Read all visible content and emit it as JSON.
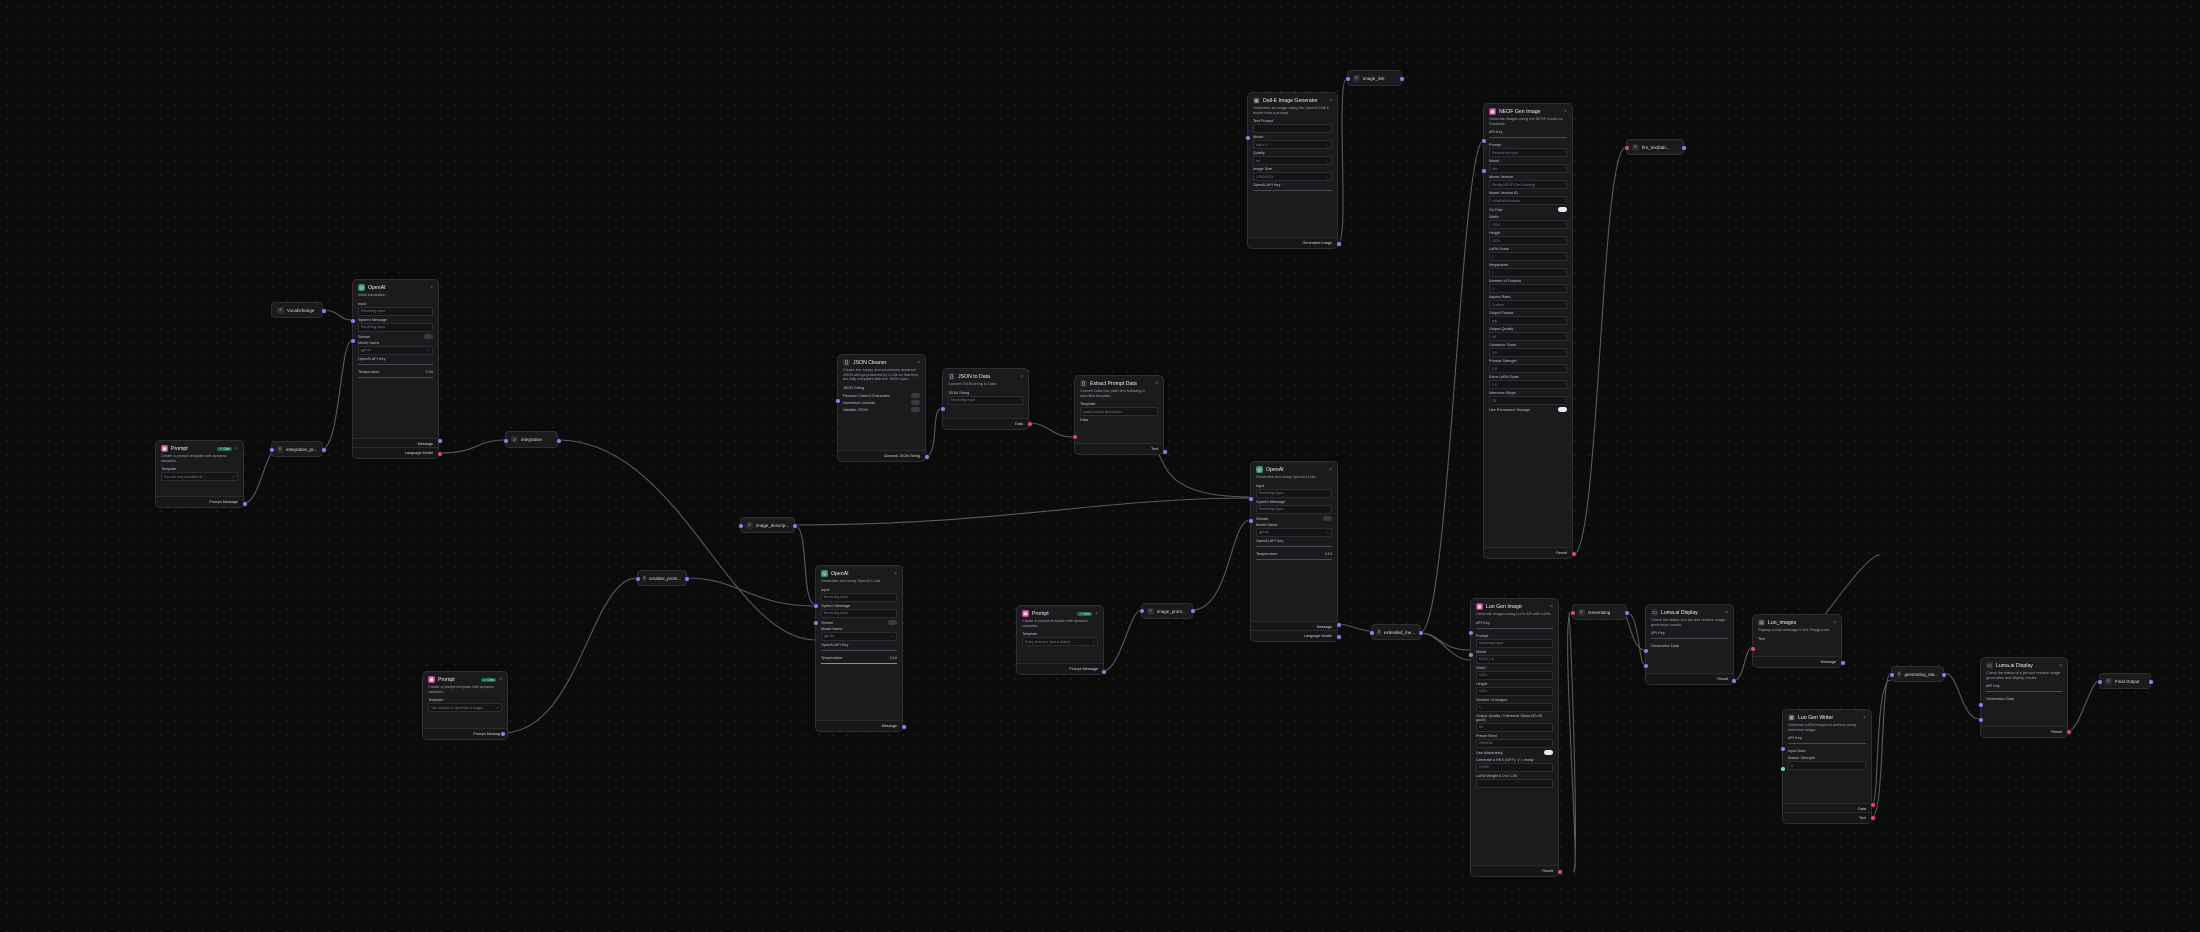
{
  "nodes": {
    "prompt1": {
      "title": "Prompt",
      "badge": "✓ Gen",
      "desc": "Create a prompt template with dynamic variables.",
      "template_label": "Template",
      "template_value": "You are very excellent at ...",
      "output": "Prompt Message"
    },
    "vocab": {
      "title": "Vocabchange"
    },
    "integration_pr": {
      "title": "integration_pr..."
    },
    "integration": {
      "title": "integration"
    },
    "openai1": {
      "title": "OpenAI",
      "desc": "Initial translation",
      "input_label": "Input",
      "input_ph": "Receiving input",
      "sys_label": "System Message",
      "sys_ph": "Receiving input",
      "stream_label": "Stream",
      "model_label": "Model Name",
      "model_value": "gpt-4o",
      "key_label": "OpenAI API Key",
      "temp_label": "Temperature",
      "temp_value": "0.20",
      "out1": "Message",
      "out2": "Language Model"
    },
    "creative_prom": {
      "title": "creative_prom..."
    },
    "prompt2": {
      "title": "Prompt",
      "badge": "✓ Gen",
      "desc": "Create a prompt template with dynamic variables.",
      "template_label": "Template",
      "template_value": "You must be to generate a image...",
      "output": "Prompt Message"
    },
    "json_cleaner": {
      "title": "JSON Cleaner",
      "desc": "Cleans the messy and sometimes incorrect JSON strings produced by LLMs so that they are fully compliant with the JSON spec.",
      "in_label": "JSON String",
      "t1": "Remove Control Characters",
      "t2": "Normalize Unicode",
      "t3": "Validate JSON",
      "output": "Cleaned JSON String"
    },
    "json_to_data": {
      "title": "JSON to Data",
      "desc": "Convert JSON string to Data",
      "in_label": "JSON String",
      "in_ph": "Receiving input",
      "output": "Data"
    },
    "parse_data": {
      "title": "Extract Prompt Data",
      "desc": "Convert Data into plain text following a specified template.",
      "template_label": "Template",
      "template_ph": "{data} extract description",
      "data_label": "Data",
      "output": "Text"
    },
    "image_descrip": {
      "title": "image_descrip..."
    },
    "openai2": {
      "title": "OpenAI",
      "desc": "Generates text using OpenAI LLMs.",
      "input_label": "Input",
      "input_ph": "Receiving input",
      "sys_label": "System Message",
      "sys_ph": "Receiving input",
      "stream_label": "Stream",
      "model_label": "Model Name",
      "model_value": "gpt-4o",
      "key_label": "OpenAI API Key",
      "temp_label": "Temperature",
      "temp_value": "0.10",
      "out1": "Message"
    },
    "prompt3": {
      "title": "Prompt",
      "badge": "✓ Gen",
      "desc": "Create a prompt template with dynamic variables.",
      "template_label": "Template",
      "template_value": "Every time you start a chat to ...",
      "output": "Prompt Message"
    },
    "image_prom": {
      "title": "image_prom..."
    },
    "openai3": {
      "title": "OpenAI",
      "desc": "Generates text using OpenAI LLMs.",
      "input_label": "Input",
      "input_ph": "Receiving input",
      "sys_label": "System Message",
      "sys_ph": "Receiving input",
      "stream_label": "Stream",
      "model_label": "Model Name",
      "model_value": "gpt-4o",
      "key_label": "OpenAI API Key",
      "temp_label": "Temperature",
      "temp_value": "0.10",
      "out1": "Message",
      "out2": "Language Model"
    },
    "dalle": {
      "title": "Dall-E Image Generator",
      "desc": "Generates an image using the OpenAI Dall-E model from a prompt.",
      "prompt_label": "Text Prompt",
      "model_label": "Model",
      "model_value": "dall-e-3",
      "quality_label": "Quality",
      "quality_value": "hd",
      "size_label": "Image Size",
      "size_value": "1792x1024",
      "key_label": "OpenAI API Key",
      "output": "Generated Image"
    },
    "image_link": {
      "title": "image_link"
    },
    "replicate": {
      "title": "NEOF Gen Image",
      "desc": "Generate images using the NEOF model on Replicate.",
      "fields": [
        "API Key",
        "Prompt",
        "Model",
        "Model Version",
        "Model Version ID",
        "Go Fast",
        "Width",
        "Height",
        "LoRA Scale",
        "Megapixels",
        "Number of Outputs",
        "Aspect Ratio",
        "Output Format",
        "Output Quality",
        "Guidance Scale",
        "Prompt Strength",
        "Extra LoRA Scale",
        "Inference Steps",
        "Use Permanent Storage"
      ],
      "values": [
        "",
        "Receive by input",
        "dev",
        "Strong NEOF Gen Tracking",
        "cc9e63f9c3bdeda",
        "",
        "1024",
        "1024",
        "1",
        "1",
        "1",
        "Custom",
        "jpg",
        "80",
        "3.5",
        "0.8",
        "1.0",
        "28",
        ""
      ],
      "output": "Result"
    },
    "fire_text": {
      "title": "fire_text(tab..."
    },
    "extended": {
      "title": "extended_me..."
    },
    "lora_image": {
      "title": "Luo Gen Image",
      "desc": "Generate images using Luo's API with LoRA.",
      "fields": [
        "API Key",
        "Prompt",
        "Model",
        "Width",
        "Height",
        "Number of Images",
        "Output Quality / Inference Steps (50-90, good)",
        "Preset Seed",
        "Use Moderately",
        "Generate a HEX (OFF), V = ready",
        "LoRA Weight 0.0 to 1.00"
      ],
      "values": [
        "",
        "Receiving input",
        "FLUX 1.0",
        "1024",
        "1024",
        "1",
        "50",
        "2864762",
        "",
        "17000",
        ""
      ],
      "output": "Result"
    },
    "generating": {
      "title": "Generating"
    },
    "luna_display": {
      "title": "Luma.ai Display",
      "desc": "Check the status of a job and retrieve image generation results.",
      "key_label": "API Key",
      "gen_label": "Generation Data",
      "output": "Result"
    },
    "luo_images": {
      "title": "Luo_images",
      "desc": "Display a chat message in the Playground.",
      "text_label": "Text",
      "output": "Message"
    },
    "luo_writer": {
      "title": "Luo Gen Writer",
      "desc": "Generate LoRA images to perform using reference image.",
      "key_label": "API Key",
      "input_label": "Input Data",
      "weight_label": "Motion Strength",
      "weight_value": "3",
      "out1": "Data",
      "out2": "Text"
    },
    "generating_sta": {
      "title": "generating_sta..."
    },
    "luma_display2": {
      "title": "Luma.ai Display",
      "desc": "Check the status of a job and retrieve image generation and display results.",
      "key_label": "API Key",
      "gen_label": "Generation Data",
      "output": "Result"
    },
    "final_output": {
      "title": "Final Output"
    }
  }
}
